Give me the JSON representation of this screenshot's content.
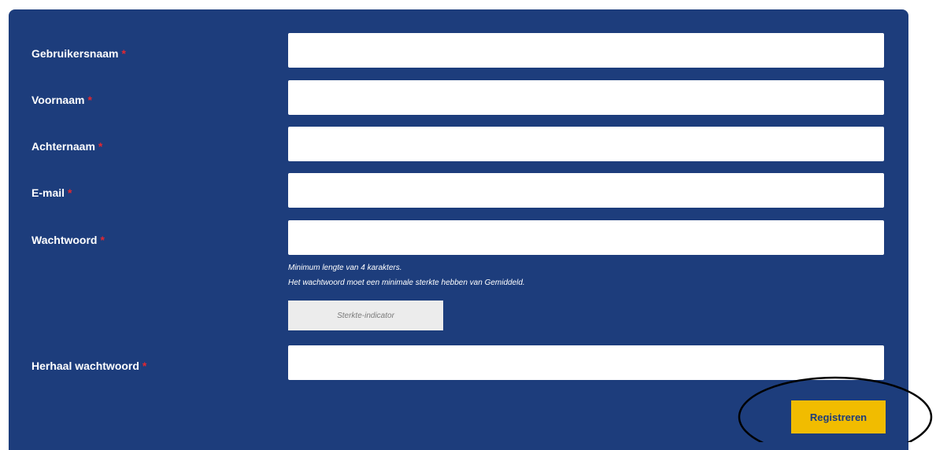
{
  "form": {
    "fields": [
      {
        "label": "Gebruikersnaam",
        "required_mark": "*",
        "value": ""
      },
      {
        "label": "Voornaam",
        "required_mark": "*",
        "value": ""
      },
      {
        "label": "Achternaam",
        "required_mark": "*",
        "value": ""
      },
      {
        "label": "E-mail",
        "required_mark": "*",
        "value": ""
      },
      {
        "label": "Wachtwoord",
        "required_mark": "*",
        "value": ""
      },
      {
        "label": "Herhaal wachtwoord",
        "required_mark": "*",
        "value": ""
      }
    ],
    "password_hints": [
      "Minimum lengte van 4 karakters.",
      "Het wachtwoord moet een minimale sterkte hebben van Gemiddeld."
    ],
    "strength_indicator": "Sterkte-indicator",
    "submit_label": "Registreren"
  },
  "colors": {
    "panel": "#1d3d7c",
    "required": "#e32730",
    "button": "#f1bc00"
  }
}
